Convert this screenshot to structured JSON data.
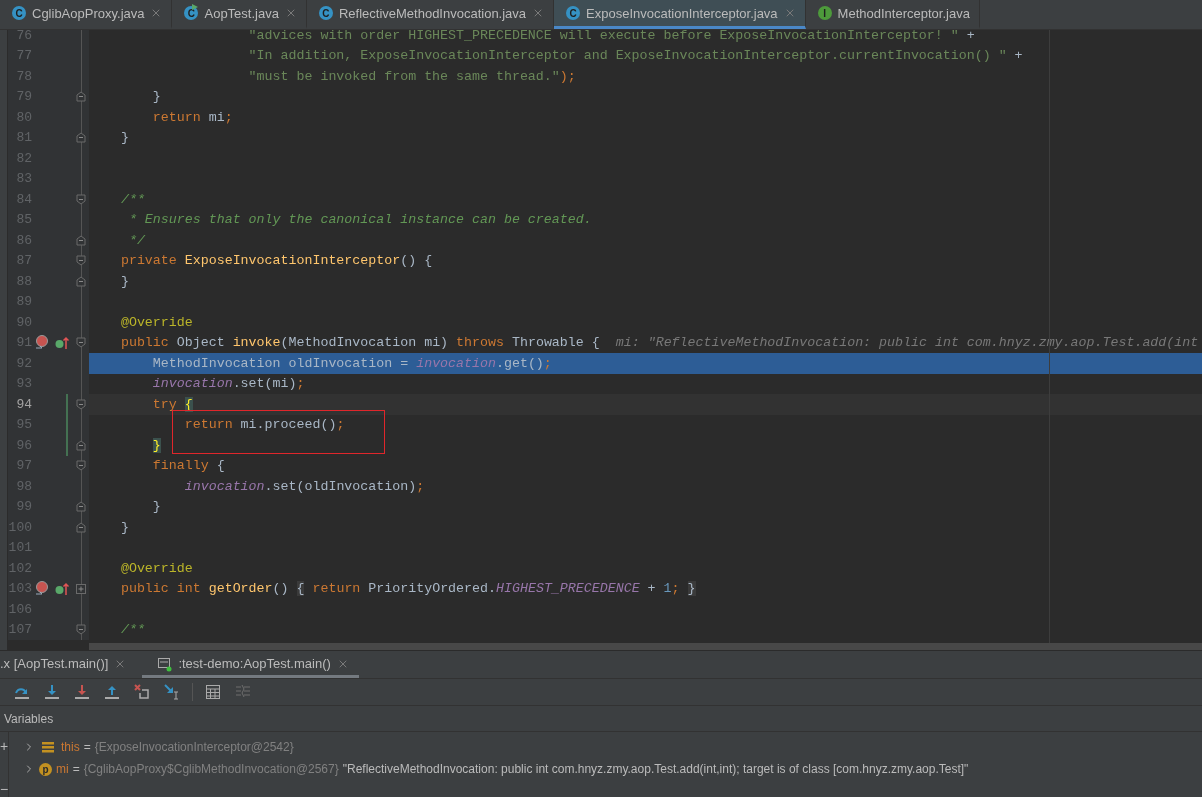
{
  "tabs": [
    {
      "label": "CglibAopProxy.java",
      "icon_letter": "C",
      "color": "#3592c4",
      "runnable": false,
      "close": true,
      "selected": false
    },
    {
      "label": "AopTest.java",
      "icon_letter": "C",
      "color": "#3592c4",
      "runnable": true,
      "close": true,
      "selected": false
    },
    {
      "label": "ReflectiveMethodInvocation.java",
      "icon_letter": "C",
      "color": "#3592c4",
      "runnable": false,
      "close": true,
      "selected": false
    },
    {
      "label": "ExposeInvocationInterceptor.java",
      "icon_letter": "C",
      "color": "#3592c4",
      "runnable": false,
      "close": true,
      "selected": true
    },
    {
      "label": "MethodInterceptor.java",
      "icon_letter": "I",
      "color": "#4d9a3b",
      "runnable": false,
      "close": false,
      "selected": false
    }
  ],
  "editor": {
    "lines": [
      {
        "number": "76",
        "gutter_icons": false,
        "changed": false,
        "current": false,
        "execution": false,
        "boxed": false,
        "tokens": [
          {
            "kind": "string",
            "text": "                    \"advices with order HIGHEST_PRECEDENCE will execute before ExposeInvocationInterceptor! \""
          },
          {
            "kind": "plain",
            "text": " +"
          }
        ]
      },
      {
        "number": "77",
        "gutter_icons": false,
        "changed": false,
        "current": false,
        "execution": false,
        "boxed": false,
        "tokens": [
          {
            "kind": "string",
            "text": "                    \"In addition, ExposeInvocationInterceptor and ExposeInvocationInterceptor.currentInvocation() \""
          },
          {
            "kind": "plain",
            "text": " +"
          }
        ]
      },
      {
        "number": "78",
        "gutter_icons": false,
        "changed": false,
        "current": false,
        "execution": false,
        "boxed": false,
        "tokens": [
          {
            "kind": "string",
            "text": "                    \"must be invoked from the same thread.\""
          },
          {
            "kind": "punct",
            "text": ");"
          }
        ]
      },
      {
        "number": "79",
        "fold": {
          "kind": "end"
        },
        "gutter_icons": false,
        "changed": false,
        "current": false,
        "execution": false,
        "boxed": false,
        "tokens": [
          {
            "kind": "plain",
            "text": "        }"
          }
        ]
      },
      {
        "number": "80",
        "gutter_icons": false,
        "changed": false,
        "current": false,
        "execution": false,
        "boxed": false,
        "tokens": [
          {
            "kind": "keyword",
            "text": "        return"
          },
          {
            "kind": "plain",
            "text": " mi"
          },
          {
            "kind": "punct",
            "text": ";"
          }
        ]
      },
      {
        "number": "81",
        "fold": {
          "kind": "end"
        },
        "gutter_icons": false,
        "changed": false,
        "current": false,
        "execution": false,
        "boxed": false,
        "tokens": [
          {
            "kind": "plain",
            "text": "    }"
          }
        ]
      },
      {
        "number": "82",
        "gutter_icons": false,
        "changed": false,
        "current": false,
        "execution": false,
        "boxed": false
      },
      {
        "number": "83",
        "gutter_icons": false,
        "changed": false,
        "current": false,
        "execution": false,
        "boxed": false
      },
      {
        "number": "84",
        "fold": {
          "kind": "start"
        },
        "gutter_icons": false,
        "changed": false,
        "current": false,
        "execution": false,
        "boxed": false,
        "tokens": [
          {
            "kind": "doc",
            "text": "    /**"
          }
        ]
      },
      {
        "number": "85",
        "gutter_icons": false,
        "changed": false,
        "current": false,
        "execution": false,
        "boxed": false,
        "tokens": [
          {
            "kind": "doc",
            "text": "     * Ensures that only the canonical instance can be created."
          }
        ]
      },
      {
        "number": "86",
        "fold": {
          "kind": "end"
        },
        "gutter_icons": false,
        "changed": false,
        "current": false,
        "execution": false,
        "boxed": false,
        "tokens": [
          {
            "kind": "doc",
            "text": "     */"
          }
        ]
      },
      {
        "number": "87",
        "fold": {
          "kind": "start"
        },
        "gutter_icons": false,
        "changed": false,
        "current": false,
        "execution": false,
        "boxed": false,
        "tokens": [
          {
            "kind": "keyword",
            "text": "    private "
          },
          {
            "kind": "method",
            "text": "ExposeInvocationInterceptor"
          },
          {
            "kind": "plain",
            "text": "() {"
          }
        ]
      },
      {
        "number": "88",
        "fold": {
          "kind": "end"
        },
        "gutter_icons": false,
        "changed": false,
        "current": false,
        "execution": false,
        "boxed": false,
        "tokens": [
          {
            "kind": "plain",
            "text": "    }"
          }
        ]
      },
      {
        "number": "89",
        "gutter_icons": false,
        "changed": false,
        "current": false,
        "execution": false,
        "boxed": false
      },
      {
        "number": "90",
        "gutter_icons": false,
        "changed": false,
        "current": false,
        "execution": false,
        "boxed": false,
        "tokens": [
          {
            "kind": "annotation",
            "text": "    @Override"
          }
        ]
      },
      {
        "number": "91",
        "fold": {
          "kind": "start"
        },
        "gutter_icons": true,
        "changed": false,
        "current": false,
        "execution": false,
        "boxed": false,
        "tokens": [
          {
            "kind": "keyword",
            "text": "    public"
          },
          {
            "kind": "plain",
            "text": " Object "
          },
          {
            "kind": "method",
            "text": "invoke"
          },
          {
            "kind": "plain",
            "text": "(MethodInvocation mi) "
          },
          {
            "kind": "keyword",
            "text": "throws"
          },
          {
            "kind": "plain",
            "text": " Throwable {"
          }
        ],
        "hint": "mi: \"ReflectiveMethodInvocation: public int com.hnyz.zmy.aop.Test.add(int"
      },
      {
        "number": "92",
        "gutter_icons": false,
        "changed": false,
        "current": false,
        "execution": true,
        "boxed": false,
        "tokens": [
          {
            "kind": "plain",
            "text": "        MethodInvocation oldInvocation = "
          },
          {
            "kind": "field",
            "text": "invocation"
          },
          {
            "kind": "plain",
            "text": ".get()"
          },
          {
            "kind": "punct",
            "text": ";"
          }
        ]
      },
      {
        "number": "93",
        "gutter_icons": false,
        "changed": false,
        "current": false,
        "execution": false,
        "boxed": false,
        "tokens": [
          {
            "kind": "field",
            "text": "        invocation"
          },
          {
            "kind": "plain",
            "text": ".set(mi)"
          },
          {
            "kind": "punct",
            "text": ";"
          }
        ]
      },
      {
        "number": "94",
        "fold": {
          "kind": "start"
        },
        "gutter_icons": false,
        "changed": true,
        "current": true,
        "execution": false,
        "boxed": false,
        "tokens": [
          {
            "kind": "keyword",
            "text": "        try "
          },
          {
            "kind": "match",
            "text": "{"
          }
        ]
      },
      {
        "number": "95",
        "gutter_icons": false,
        "changed": true,
        "current": false,
        "execution": false,
        "boxed": true,
        "tokens": [
          {
            "kind": "keyword",
            "text": "            return"
          },
          {
            "kind": "plain",
            "text": " mi.proceed()"
          },
          {
            "kind": "punct",
            "text": ";"
          }
        ]
      },
      {
        "number": "96",
        "fold": {
          "kind": "end"
        },
        "gutter_icons": false,
        "changed": true,
        "current": false,
        "execution": false,
        "boxed": false,
        "tokens": [
          {
            "kind": "match",
            "text": "        }"
          }
        ]
      },
      {
        "number": "97",
        "fold": {
          "kind": "start"
        },
        "gutter_icons": false,
        "changed": false,
        "current": false,
        "execution": false,
        "boxed": false,
        "tokens": [
          {
            "kind": "keyword",
            "text": "        finally"
          },
          {
            "kind": "plain",
            "text": " {"
          }
        ]
      },
      {
        "number": "98",
        "gutter_icons": false,
        "changed": false,
        "current": false,
        "execution": false,
        "boxed": false,
        "tokens": [
          {
            "kind": "field",
            "text": "            invocation"
          },
          {
            "kind": "plain",
            "text": ".set(oldInvocation)"
          },
          {
            "kind": "punct",
            "text": ";"
          }
        ]
      },
      {
        "number": "99",
        "fold": {
          "kind": "end"
        },
        "gutter_icons": false,
        "changed": false,
        "current": false,
        "execution": false,
        "boxed": false,
        "tokens": [
          {
            "kind": "plain",
            "text": "        }"
          }
        ]
      },
      {
        "number": "100",
        "fold": {
          "kind": "end"
        },
        "gutter_icons": false,
        "changed": false,
        "current": false,
        "execution": false,
        "boxed": false,
        "tokens": [
          {
            "kind": "plain",
            "text": "    }"
          }
        ]
      },
      {
        "number": "101",
        "gutter_icons": false,
        "changed": false,
        "current": false,
        "execution": false,
        "boxed": false
      },
      {
        "number": "102",
        "gutter_icons": false,
        "changed": false,
        "current": false,
        "execution": false,
        "boxed": false,
        "tokens": [
          {
            "kind": "annotation",
            "text": "    @Override"
          }
        ]
      },
      {
        "number": "103",
        "fold": {
          "kind": "collapsed"
        },
        "gutter_icons": true,
        "changed": false,
        "current": false,
        "execution": false,
        "boxed": false,
        "tokens": [
          {
            "kind": "keyword",
            "text": "    public int "
          },
          {
            "kind": "method",
            "text": "getOrder"
          },
          {
            "kind": "plain",
            "text": "() "
          },
          {
            "kind": "folded",
            "text": "{"
          },
          {
            "kind": "keyword",
            "text": " return"
          },
          {
            "kind": "plain",
            "text": " PriorityOrdered."
          },
          {
            "kind": "field",
            "text": "HIGHEST_PRECEDENCE"
          },
          {
            "kind": "plain",
            "text": " + "
          },
          {
            "kind": "number",
            "text": "1"
          },
          {
            "kind": "punct",
            "text": ";"
          },
          {
            "kind": "folded",
            "text": " }"
          }
        ]
      },
      {
        "number": "106",
        "gutter_icons": false,
        "changed": false,
        "current": false,
        "execution": false,
        "boxed": false
      },
      {
        "number": "107",
        "fold": {
          "kind": "start"
        },
        "gutter_icons": false,
        "changed": false,
        "current": false,
        "execution": false,
        "boxed": false,
        "tokens": [
          {
            "kind": "doc",
            "text": "    /**"
          }
        ]
      }
    ]
  },
  "debug": {
    "tabs": [
      {
        "label": ".x [AopTest.main()]",
        "icon": false,
        "selected": false
      },
      {
        "label": ":test-demo:AopTest.main()",
        "icon": true,
        "selected": true
      }
    ],
    "toolbar": [
      {
        "kind": "step-over",
        "disabled": false
      },
      {
        "kind": "step-into",
        "disabled": false
      },
      {
        "kind": "force-step-into",
        "disabled": false
      },
      {
        "kind": "step-out",
        "disabled": false
      },
      {
        "kind": "drop-frame",
        "disabled": false
      },
      {
        "kind": "run-to-cursor",
        "disabled": false
      },
      {
        "kind": "evaluate",
        "disabled": false
      },
      {
        "kind": "trace",
        "disabled": true
      }
    ],
    "variables_title": "Variables",
    "side_buttons": [
      "+",
      "−"
    ],
    "variables": [
      {
        "kind": "fields",
        "name": "this",
        "equals": "=",
        "value": "{ExposeInvocationInterceptor@2542}",
        "expanded": false
      },
      {
        "kind": "param",
        "badge": "p",
        "name": "mi",
        "equals": "=",
        "value": "{CglibAopProxy$CglibMethodInvocation@2567}",
        "text": "\"ReflectiveMethodInvocation: public int com.hnyz.zmy.aop.Test.add(int,int); target is of class [com.hnyz.zmy.aop.Test]\"",
        "expanded": false
      }
    ]
  }
}
